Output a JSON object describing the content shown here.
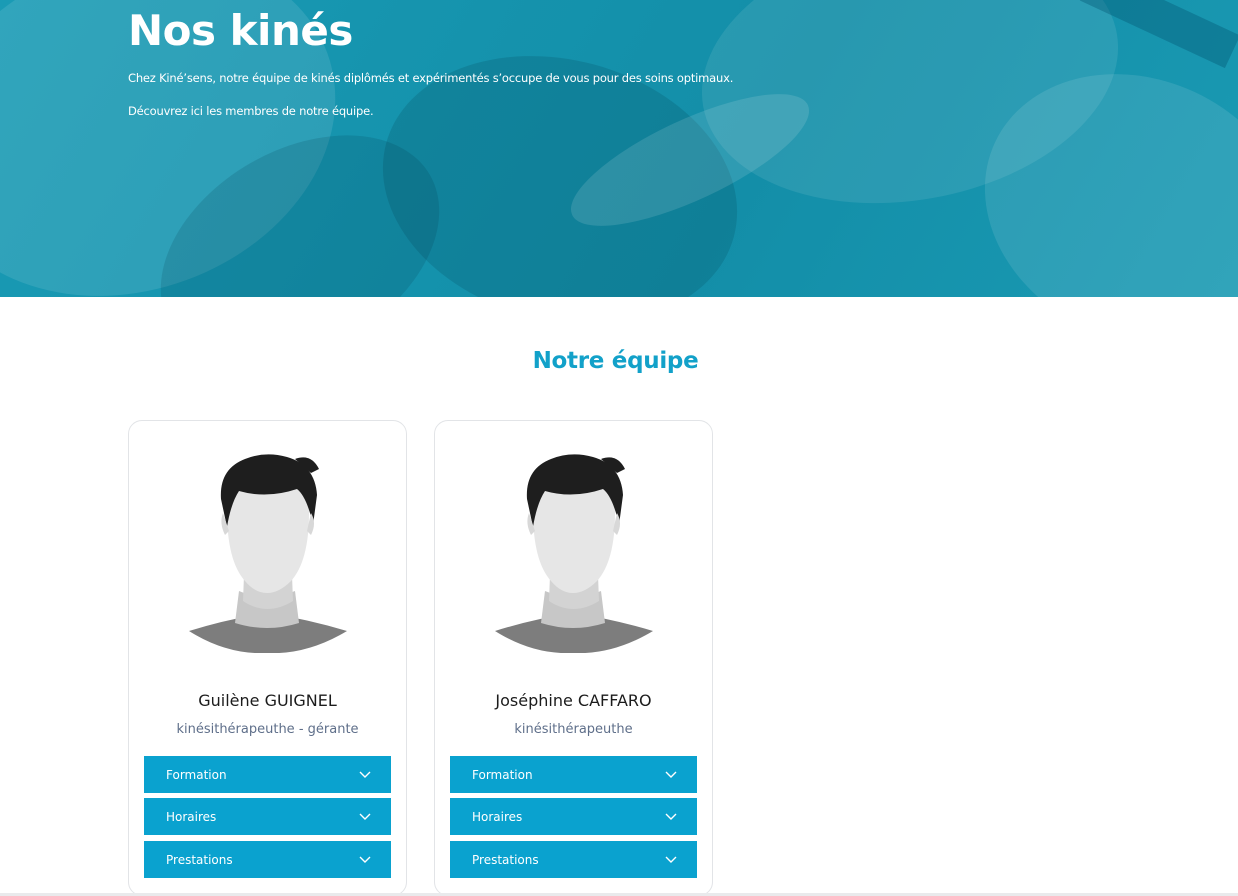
{
  "hero": {
    "title": "Nos kinés",
    "paragraph_1": "Chez Kiné’sens, notre équipe de kinés diplômés et expérimentés s’occupe de vous pour des soins optimaux.",
    "paragraph_2": "Découvrez ici les membres de notre équipe."
  },
  "team": {
    "title": "Notre équipe",
    "members": [
      {
        "name": "Guilène GUIGNEL",
        "role": "kinésithérapeuthe - gérante",
        "sections": [
          "Formation",
          "Horaires",
          "Prestations"
        ]
      },
      {
        "name": "Joséphine CAFFARO",
        "role": "kinésithérapeuthe",
        "sections": [
          "Formation",
          "Horaires",
          "Prestations"
        ]
      }
    ]
  },
  "colors": {
    "accent": "#0aa2cf",
    "hero_bg": "#1593ad",
    "title_teal": "#12a1c9",
    "role_text": "#5f6f8a"
  },
  "icons": {
    "avatar": "avatar-placeholder-icon",
    "accordion": "chevron-down-icon"
  }
}
